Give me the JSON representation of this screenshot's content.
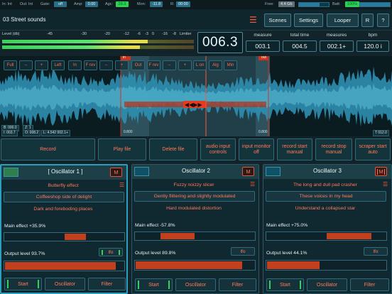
{
  "status": {
    "in_label": "In: Int",
    "out_label": "Out: Int",
    "gate_label": "Gate:",
    "gate_value": "off",
    "amp_label": "Amp:",
    "amp_value": "0.00",
    "agc_label": "Agc:",
    "agc_value": "28.3",
    "mon_label": "Mon:",
    "mon_value": "-11.8",
    "r_label": "R:",
    "r_value": "00:00",
    "free_label": "Free:",
    "free_value": "4.4 Gb",
    "batt_label": "Batt:",
    "batt_value": "100%"
  },
  "header": {
    "project_title": "03 Street sounds",
    "scenes": "Scenes",
    "settings": "Settings",
    "looper": "Looper",
    "r_btn": "R",
    "help": "?"
  },
  "meters": {
    "level_label": "Level (db)",
    "ticks": [
      "-45",
      "-30",
      "-20",
      "-12",
      "-6",
      "-3",
      "0",
      "-16",
      "-8",
      "Limiter"
    ],
    "left_level": 0.76,
    "right_level": 0.72
  },
  "counter": "006.3",
  "info": {
    "headers": [
      "measure",
      "total time",
      "measures",
      "bpm"
    ],
    "values": [
      "003.1",
      "004.5",
      "002.1+",
      "120.0 i"
    ]
  },
  "wave": {
    "buttons": [
      "Full",
      "–",
      "+",
      "Left",
      "In",
      "F rev",
      "–",
      "+",
      "Out",
      "F rev",
      "–",
      "+",
      "L on",
      "Alg",
      "Min"
    ],
    "in_marker": "in",
    "out_marker": "out",
    "b_label": "B: 000.0",
    "z_label": "Z: 1",
    "i_label": "I: 003.7",
    "o_label": "O: 008.2",
    "l_label": "L: 4.542 002.1+",
    "t_label": "T 012.0",
    "time_a": "0.800",
    "time_b": "0.800"
  },
  "controls": {
    "record": "Record",
    "play": "Play file",
    "delete": "Delete file",
    "audio_input_1": "audio input",
    "audio_input_2": "controls",
    "monitor_1": "input monitor",
    "monitor_2": "off",
    "rec_start_1": "record start",
    "rec_start_2": "manual",
    "rec_stop_1": "record stop",
    "rec_stop_2": "manual",
    "scraper_1": "scraper start",
    "scraper_2": "auto"
  },
  "oscillators": [
    {
      "title": "[  Oscillator 1  ]",
      "mute": "M",
      "preset_top": "Butterfly effect",
      "preset_selected": "Coffeeshop side of delight",
      "preset_bottom": "Dark and foreboding places",
      "main_effect_label": "Main effect +35.9%",
      "main_effect": 0.359,
      "output_label": "Output level 93.7%",
      "output": 0.937,
      "lfo": "lfo",
      "start": "Start",
      "osc_btn": "Oscillator",
      "filter": "Filter"
    },
    {
      "title": "Oscillator 2",
      "mute": "M",
      "preset_top": "Fuzzy noizzy slicer",
      "preset_selected": "Gently flittering and slightly modulated",
      "preset_bottom": "Hard modulated distortion",
      "main_effect_label": "Main effect -57.8%",
      "main_effect": -0.578,
      "output_label": "Output level 89.8%",
      "output": 0.898,
      "lfo": "lfo",
      "start": "Start",
      "osc_btn": "Oscillator",
      "filter": "Filter"
    },
    {
      "title": "Oscillator 3",
      "mute": "M",
      "preset_top": "The long and dull pad crasher",
      "preset_selected": "These voices in my head",
      "preset_bottom": "Understand a collapsed star",
      "main_effect_label": "Main effect +75.0%",
      "main_effect": 0.75,
      "output_label": "Output level 44.1%",
      "output": 0.441,
      "lfo": "lfo",
      "start": "Start",
      "osc_btn": "Oscillator",
      "filter": "Filter"
    }
  ],
  "colors": {
    "accent": "#ff7a5c",
    "meter_green": "#3bd35a",
    "slider_fill": "#c3401f",
    "panel_border": "#2f6b7c"
  }
}
